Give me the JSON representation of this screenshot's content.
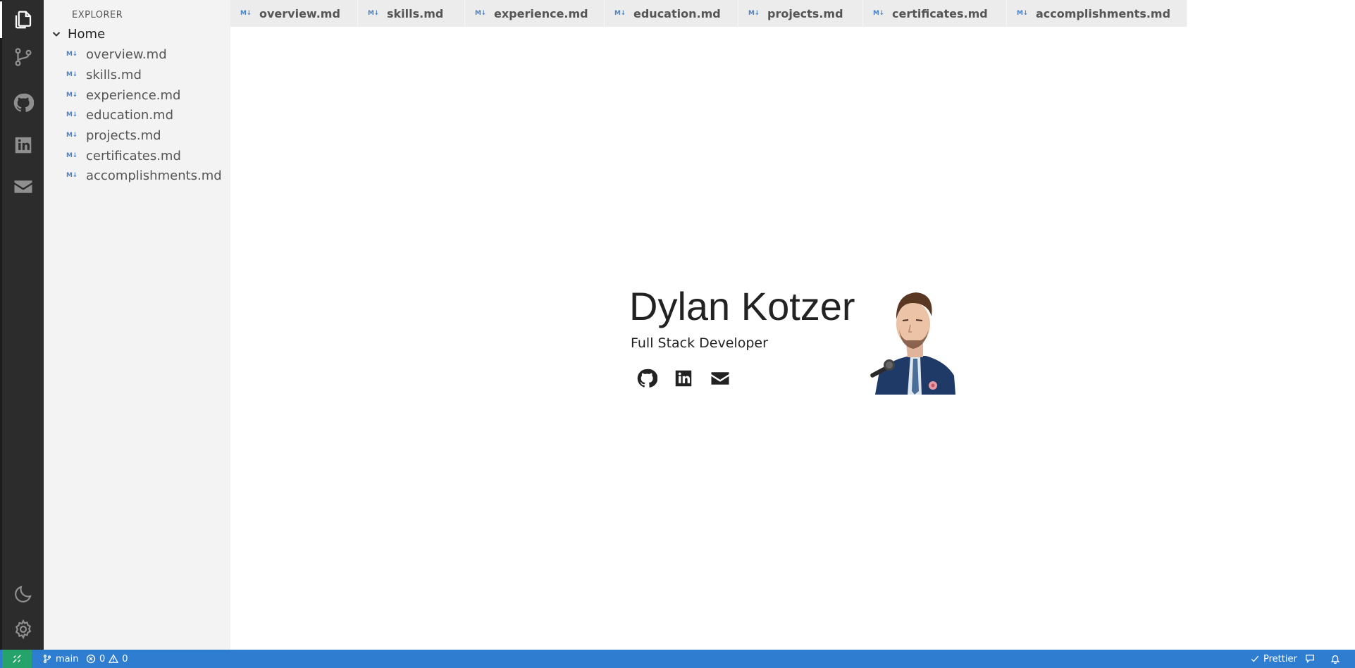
{
  "activity_bar": {
    "items": [
      {
        "icon": "files-icon",
        "active": true
      },
      {
        "icon": "source-control-icon"
      },
      {
        "icon": "github-icon"
      },
      {
        "icon": "linkedin-icon"
      },
      {
        "icon": "mail-icon"
      }
    ],
    "bottom_items": [
      {
        "icon": "moon-icon"
      },
      {
        "icon": "gear-icon"
      }
    ]
  },
  "sidebar": {
    "title": "EXPLORER",
    "folder_label": "Home",
    "file_icon_text": "M↓",
    "files": [
      {
        "label": "overview.md"
      },
      {
        "label": "skills.md"
      },
      {
        "label": "experience.md"
      },
      {
        "label": "education.md"
      },
      {
        "label": "projects.md"
      },
      {
        "label": "certificates.md"
      },
      {
        "label": "accomplishments.md"
      }
    ]
  },
  "tabs": [
    {
      "label": "overview.md"
    },
    {
      "label": "skills.md"
    },
    {
      "label": "experience.md"
    },
    {
      "label": "education.md"
    },
    {
      "label": "projects.md"
    },
    {
      "label": "certificates.md"
    },
    {
      "label": "accomplishments.md"
    }
  ],
  "hero": {
    "name": "Dylan Kotzer",
    "title": "Full Stack Developer",
    "links": [
      {
        "icon": "github-icon"
      },
      {
        "icon": "linkedin-icon"
      },
      {
        "icon": "mail-icon"
      }
    ]
  },
  "statusbar": {
    "branch": "main",
    "errors": "0",
    "warnings": "0",
    "formatter": "Prettier"
  },
  "colors": {
    "statusbar": "#2f7dd1",
    "remote": "#25a36b",
    "activity_bar": "#2c2c2c",
    "sidebar": "#f3f3f3"
  }
}
